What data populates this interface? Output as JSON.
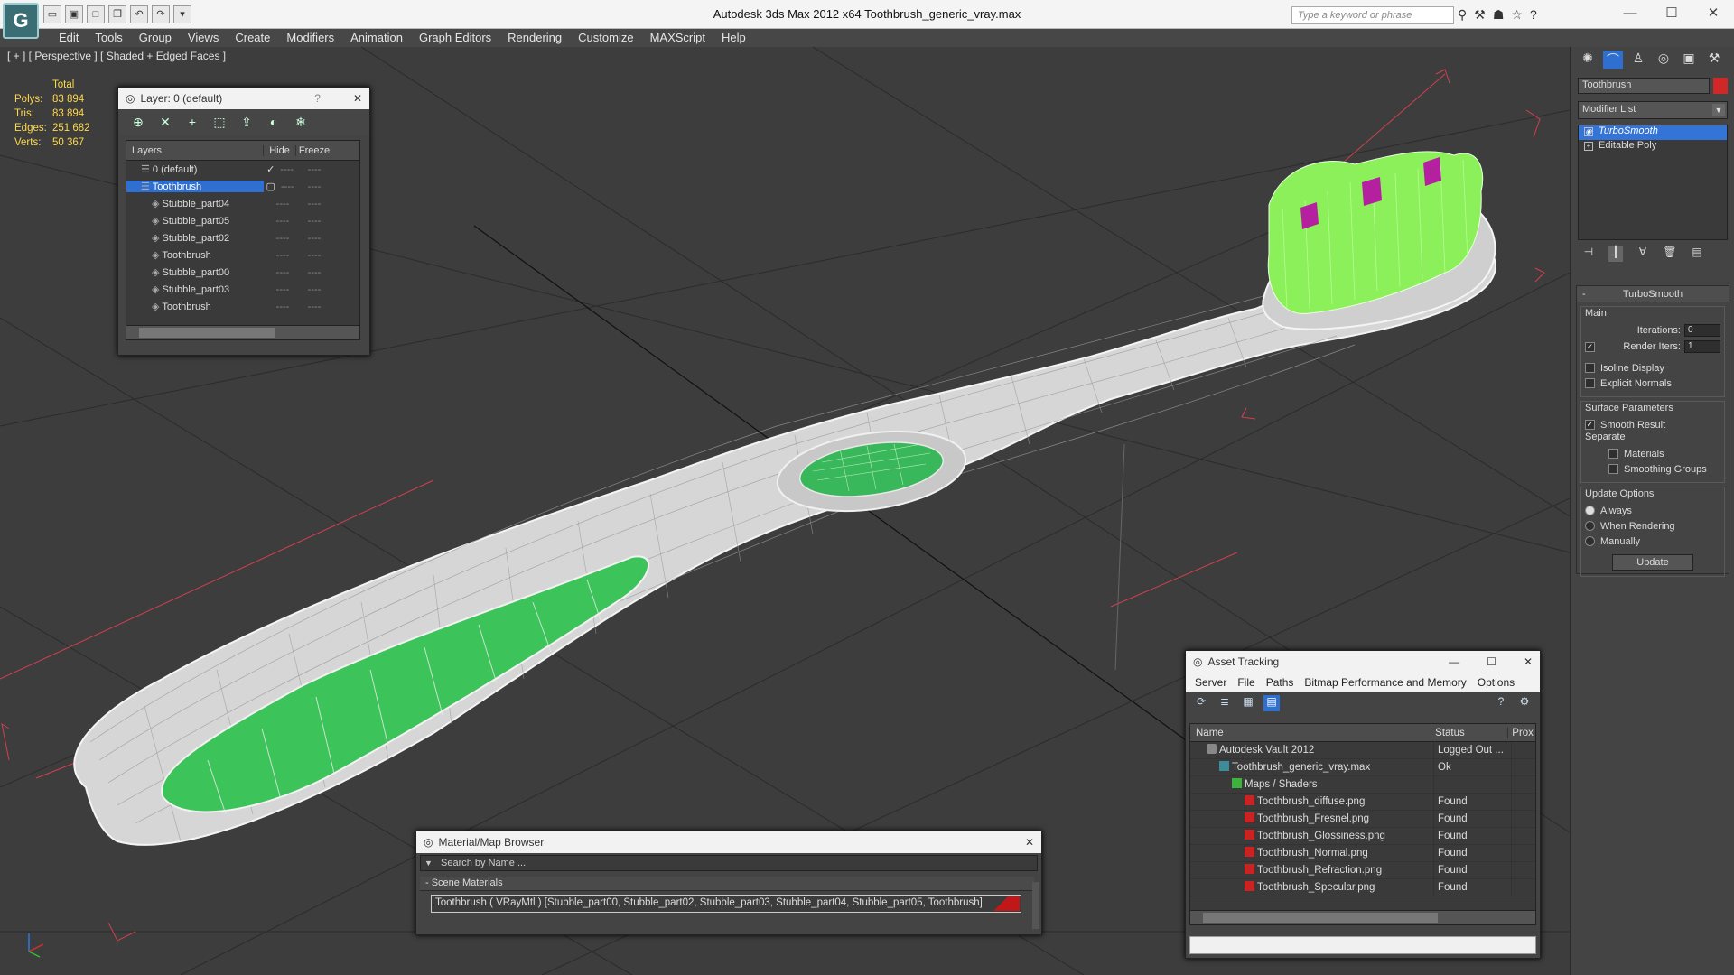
{
  "app": {
    "logo_letter": "G",
    "window_title": "Autodesk 3ds Max  2012 x64      Toothbrush_generic_vray.max",
    "search_placeholder": "Type a keyword or phrase",
    "qa_buttons": [
      "open-icon",
      "save-icon",
      "new-icon",
      "copy-icon",
      "undo-icon",
      "redo-icon",
      "dropdown-icon"
    ],
    "title_icons": [
      "binoculars-icon",
      "tools-icon",
      "hat-icon",
      "star-icon",
      "help-icon"
    ],
    "window_controls": [
      "—",
      "☐",
      "✕"
    ]
  },
  "menu": [
    "Edit",
    "Tools",
    "Group",
    "Views",
    "Create",
    "Modifiers",
    "Animation",
    "Graph Editors",
    "Rendering",
    "Customize",
    "MAXScript",
    "Help"
  ],
  "viewport": {
    "label": "[ + ] [ Perspective ] [ Shaded + Edged Faces ]",
    "stats": {
      "total_label": "Total",
      "rows": [
        {
          "k": "Polys:",
          "v": "83 894"
        },
        {
          "k": "Tris:",
          "v": "83 894"
        },
        {
          "k": "Edges:",
          "v": "251 682"
        },
        {
          "k": "Verts:",
          "v": "50 367"
        }
      ]
    }
  },
  "layer_window": {
    "title": "Layer: 0 (default)",
    "help": "?",
    "close": "✕",
    "tools": [
      "create-layer-icon",
      "delete-icon",
      "add-icon",
      "select-icon",
      "highlight-icon",
      "hide-all-icon",
      "freeze-all-icon"
    ],
    "columns": {
      "layers": "Layers",
      "hide": "Hide",
      "freeze": "Freeze"
    },
    "rows": [
      {
        "name": "0 (default)",
        "indent": 1,
        "mark": "✓",
        "selected": false
      },
      {
        "name": "Toothbrush",
        "indent": 1,
        "mark": "▢",
        "selected": true
      },
      {
        "name": "Stubble_part04",
        "indent": 2,
        "mark": "",
        "selected": false
      },
      {
        "name": "Stubble_part05",
        "indent": 2,
        "mark": "",
        "selected": false
      },
      {
        "name": "Stubble_part02",
        "indent": 2,
        "mark": "",
        "selected": false
      },
      {
        "name": "Toothbrush",
        "indent": 2,
        "mark": "",
        "selected": false
      },
      {
        "name": "Stubble_part00",
        "indent": 2,
        "mark": "",
        "selected": false
      },
      {
        "name": "Stubble_part03",
        "indent": 2,
        "mark": "",
        "selected": false
      },
      {
        "name": "Toothbrush",
        "indent": 2,
        "mark": "",
        "selected": false
      }
    ],
    "dash": "----"
  },
  "command_panel": {
    "tabs": [
      "create-icon",
      "modify-icon",
      "hierarchy-icon",
      "motion-icon",
      "display-icon",
      "utilities-icon"
    ],
    "object_name": "Toothbrush",
    "object_color": "#d02828",
    "modifier_list": "Modifier List",
    "stack": [
      {
        "name": "TurboSmooth",
        "selected": true,
        "icon": "◉"
      },
      {
        "name": "Editable Poly",
        "selected": false,
        "icon": "+"
      }
    ],
    "stack_buttons": [
      "pin-icon",
      "show-end-icon",
      "unique-icon",
      "remove-icon",
      "configure-icon"
    ],
    "rollout": {
      "title": "TurboSmooth",
      "main": {
        "label": "Main",
        "iterations_label": "Iterations:",
        "iterations": "0",
        "render_iters_label": "Render Iters:",
        "render_iters": "1",
        "isoline": "Isoline Display",
        "explicit": "Explicit Normals"
      },
      "surface": {
        "label": "Surface Parameters",
        "smooth_result": "Smooth Result",
        "separate": "Separate",
        "materials": "Materials",
        "smoothing_groups": "Smoothing Groups"
      },
      "update": {
        "label": "Update Options",
        "always": "Always",
        "when_rendering": "When Rendering",
        "manually": "Manually",
        "button": "Update"
      }
    }
  },
  "asset_tracking": {
    "title": "Asset Tracking",
    "menu": [
      "Server",
      "File",
      "Paths",
      "Bitmap Performance and Memory",
      "Options"
    ],
    "tools": [
      "refresh-icon",
      "list-icon",
      "image-icon",
      "table-icon"
    ],
    "columns": {
      "name": "Name",
      "status": "Status",
      "proxy": "Prox"
    },
    "rows": [
      {
        "name": "Autodesk Vault 2012",
        "status": "Logged Out ...",
        "indent": 1,
        "icon": "vault"
      },
      {
        "name": "Toothbrush_generic_vray.max",
        "status": "Ok",
        "indent": 2,
        "icon": "max"
      },
      {
        "name": "Maps / Shaders",
        "status": "",
        "indent": 3,
        "icon": "folder"
      },
      {
        "name": "Toothbrush_diffuse.png",
        "status": "Found",
        "indent": 4,
        "icon": "png"
      },
      {
        "name": "Toothbrush_Fresnel.png",
        "status": "Found",
        "indent": 4,
        "icon": "png"
      },
      {
        "name": "Toothbrush_Glossiness.png",
        "status": "Found",
        "indent": 4,
        "icon": "png"
      },
      {
        "name": "Toothbrush_Normal.png",
        "status": "Found",
        "indent": 4,
        "icon": "png"
      },
      {
        "name": "Toothbrush_Refraction.png",
        "status": "Found",
        "indent": 4,
        "icon": "png"
      },
      {
        "name": "Toothbrush_Specular.png",
        "status": "Found",
        "indent": 4,
        "icon": "png"
      }
    ]
  },
  "material_browser": {
    "title": "Material/Map Browser",
    "search_placeholder": "Search by Name ...",
    "category": "- Scene Materials",
    "item": "Toothbrush  ( VRayMtl ) [Stubble_part00, Stubble_part02, Stubble_part03, Stubble_part04, Stubble_part05, Toothbrush]"
  }
}
